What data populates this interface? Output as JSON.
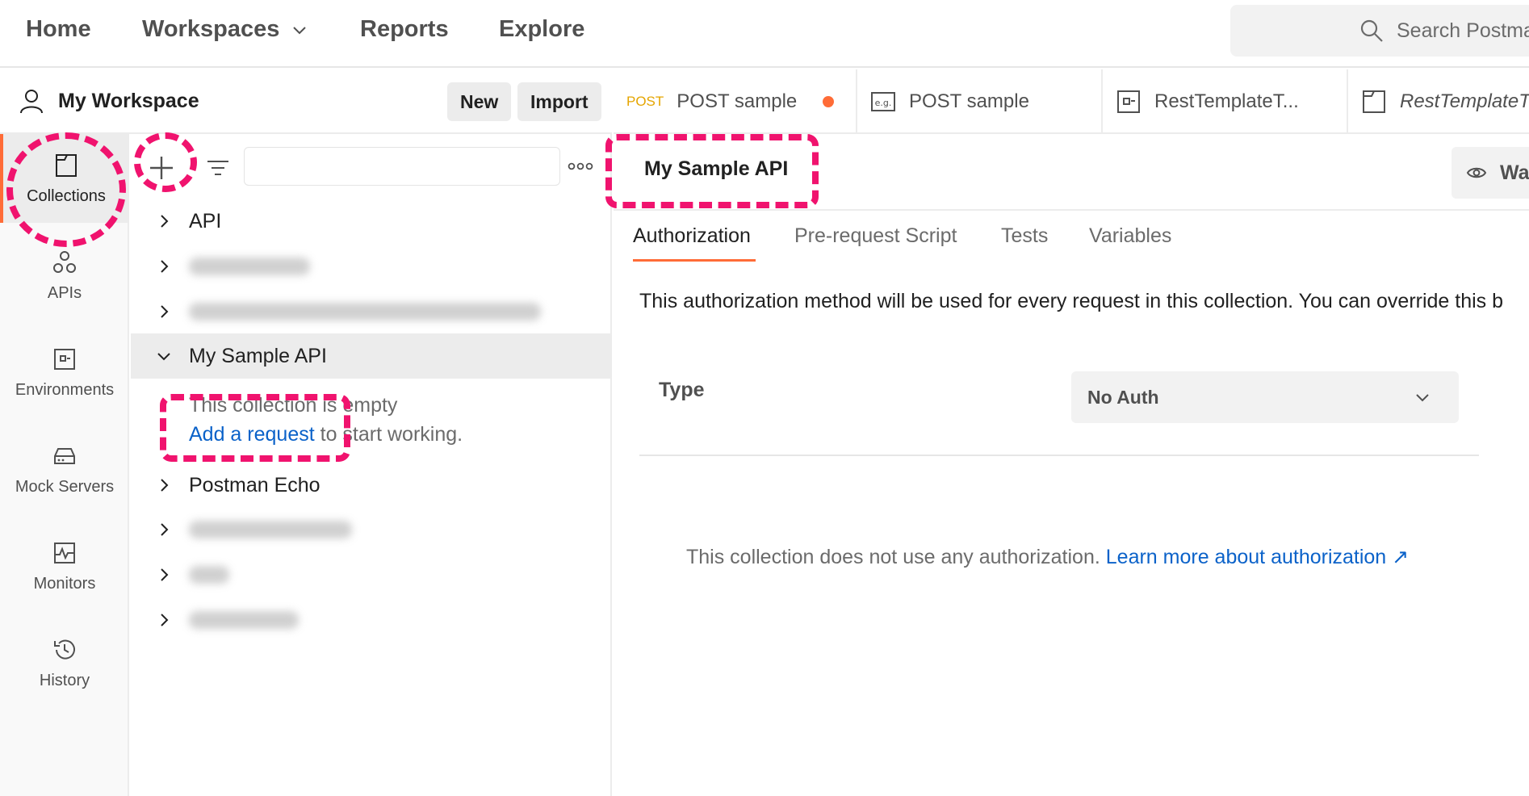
{
  "topnav": {
    "items": [
      "Home",
      "Workspaces",
      "Reports",
      "Explore"
    ],
    "search_placeholder": "Search Postma"
  },
  "workspace": {
    "title": "My Workspace",
    "new_label": "New",
    "import_label": "Import"
  },
  "rail": {
    "items": [
      "Collections",
      "APIs",
      "Environments",
      "Mock Servers",
      "Monitors",
      "History"
    ],
    "active": "Collections"
  },
  "sidebar": {
    "collections": [
      {
        "label": "API"
      },
      {
        "label": ""
      },
      {
        "label": ""
      },
      {
        "label": "My Sample API",
        "expanded": true
      },
      {
        "label": "Postman Echo"
      },
      {
        "label": ""
      },
      {
        "label": ""
      },
      {
        "label": ""
      }
    ],
    "empty_line1": "This collection is empty",
    "add_request_link": "Add a request",
    "empty_line2_rest": " to start working."
  },
  "tabs": [
    {
      "method": "POST",
      "title": "POST sample",
      "unsaved": true
    },
    {
      "icon": "example-icon",
      "title": "POST sample"
    },
    {
      "icon": "environment-icon",
      "title": "RestTemplateT..."
    },
    {
      "icon": "collection-icon",
      "title": "RestTemplateT..."
    }
  ],
  "main": {
    "title": "My Sample API",
    "watch_label": "Wa",
    "content_tabs": [
      "Authorization",
      "Pre-request Script",
      "Tests",
      "Variables"
    ],
    "active_tab": "Authorization",
    "auth_description": "This authorization method will be used for every request in this collection. You can override this b",
    "type_label": "Type",
    "type_value": "No Auth",
    "no_auth_text": "This collection does not use any authorization. ",
    "learn_more_link": "Learn more about authorization ↗"
  },
  "colors": {
    "accent": "#ff6c37",
    "link": "#0b62c9",
    "annotation": "#f0136e",
    "post_method": "#e5a500"
  }
}
